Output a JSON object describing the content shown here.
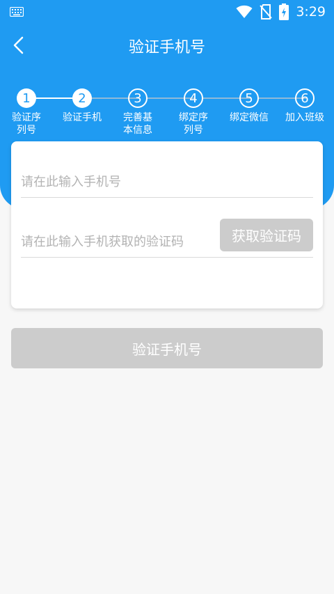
{
  "status_bar": {
    "time": "3:29",
    "icons": [
      "keyboard-icon",
      "wifi-icon",
      "no-sim-icon",
      "battery-charging-icon"
    ]
  },
  "nav": {
    "title": "验证手机号",
    "back_icon": "back-arrow-icon"
  },
  "stepper": {
    "steps": [
      {
        "number": "1",
        "label": "验证序列号",
        "state": "done"
      },
      {
        "number": "2",
        "label": "验证手机",
        "state": "done"
      },
      {
        "number": "3",
        "label": "完善基本信息",
        "state": "todo"
      },
      {
        "number": "4",
        "label": "绑定序列号",
        "state": "todo"
      },
      {
        "number": "5",
        "label": "绑定微信",
        "state": "todo"
      },
      {
        "number": "6",
        "label": "加入班级",
        "state": "todo"
      }
    ]
  },
  "form": {
    "phone_placeholder": "请在此输入手机号",
    "phone_value": "",
    "code_placeholder": "请在此输入手机获取的验证码",
    "code_value": "",
    "get_code_label": "获取验证码"
  },
  "submit_label": "验证手机号",
  "colors": {
    "primary": "#1f9bf2",
    "disabled_button": "#cccccc",
    "background": "#f7f7f7",
    "card": "#ffffff"
  }
}
